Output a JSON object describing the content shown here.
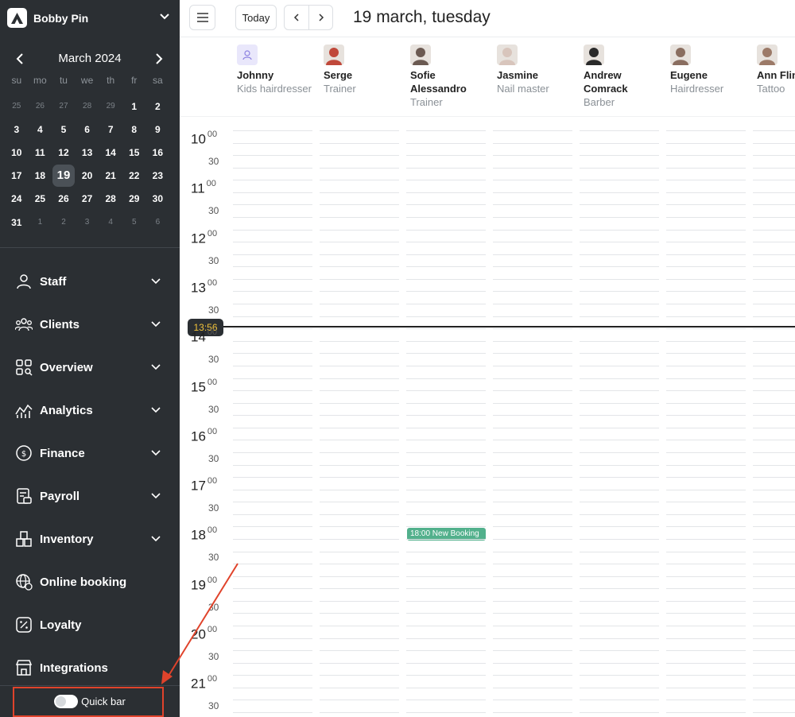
{
  "sidebar": {
    "brand": "Bobby Pin",
    "calendar": {
      "month_label": "March 2024",
      "weekdays": [
        "su",
        "mo",
        "tu",
        "we",
        "th",
        "fr",
        "sa"
      ],
      "weeks": [
        [
          "25",
          "26",
          "27",
          "28",
          "29",
          "1",
          "2"
        ],
        [
          "3",
          "4",
          "5",
          "6",
          "7",
          "8",
          "9"
        ],
        [
          "10",
          "11",
          "12",
          "13",
          "14",
          "15",
          "16"
        ],
        [
          "17",
          "18",
          "19",
          "20",
          "21",
          "22",
          "23"
        ],
        [
          "24",
          "25",
          "26",
          "27",
          "28",
          "29",
          "30"
        ],
        [
          "31",
          "1",
          "2",
          "3",
          "4",
          "5",
          "6"
        ]
      ],
      "selected_day": "19"
    },
    "nav": [
      {
        "label": "Staff",
        "icon": "user-icon",
        "expandable": true
      },
      {
        "label": "Clients",
        "icon": "users-group-icon",
        "expandable": true
      },
      {
        "label": "Overview",
        "icon": "grid-search-icon",
        "expandable": true
      },
      {
        "label": "Analytics",
        "icon": "analytics-icon",
        "expandable": true
      },
      {
        "label": "Finance",
        "icon": "dollar-icon",
        "expandable": true
      },
      {
        "label": "Payroll",
        "icon": "payroll-icon",
        "expandable": true
      },
      {
        "label": "Inventory",
        "icon": "boxes-icon",
        "expandable": true
      },
      {
        "label": "Online booking",
        "icon": "globe-icon",
        "expandable": false
      },
      {
        "label": "Loyalty",
        "icon": "percent-icon",
        "expandable": false
      },
      {
        "label": "Integrations",
        "icon": "store-icon",
        "expandable": false
      }
    ],
    "quick_bar": {
      "label": "Quick bar",
      "enabled": false
    }
  },
  "topbar": {
    "today_label": "Today",
    "date_title": "19 march, tuesday"
  },
  "staff": [
    {
      "name": "Johnny",
      "role": "Kids hairdresser",
      "avatar": "placeholder"
    },
    {
      "name": "Serge",
      "role": "Trainer",
      "avatar": "photo"
    },
    {
      "name": "Sofie Alessandro",
      "role": "Trainer",
      "avatar": "photo"
    },
    {
      "name": "Jasmine",
      "role": "Nail master",
      "avatar": "photo"
    },
    {
      "name": "Andrew Comrack",
      "role": "Barber",
      "avatar": "photo"
    },
    {
      "name": "Eugene",
      "role": "Hairdresser",
      "avatar": "photo"
    },
    {
      "name": "Ann Fling",
      "role": "Tattoo",
      "avatar": "photo"
    }
  ],
  "schedule": {
    "hours": [
      "10",
      "11",
      "12",
      "13",
      "14",
      "15",
      "16",
      "17",
      "18",
      "19",
      "20",
      "21"
    ],
    "minute_zero": "00",
    "half_label": "30",
    "current_time": "13:56",
    "bookings": [
      {
        "time": "18:00",
        "title": "New Booking",
        "staff": "Sofie Alessandro",
        "label": "18:00 New Booking"
      }
    ]
  },
  "colors": {
    "sidebar_bg": "#2b2f33",
    "booking": "#52b08c",
    "now_badge_text": "#f0c23a",
    "annotation": "#e0432b"
  }
}
